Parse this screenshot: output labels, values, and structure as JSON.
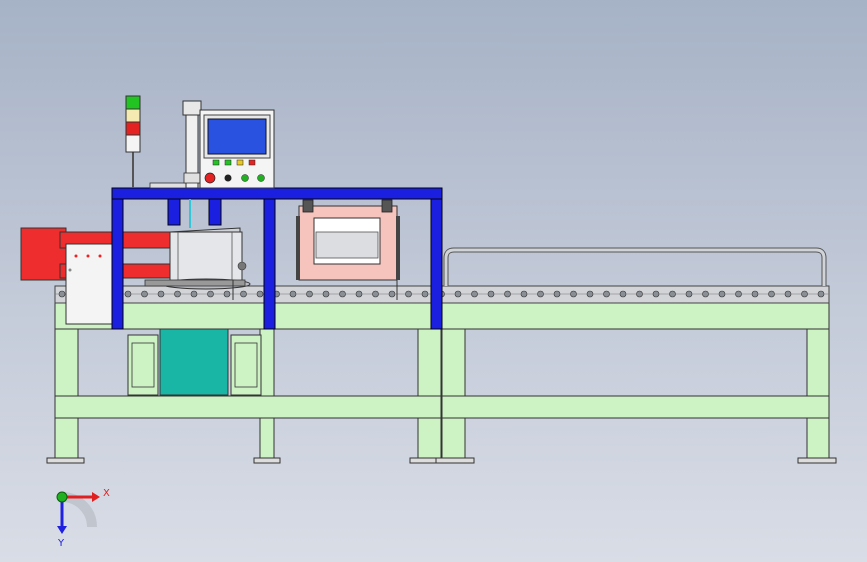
{
  "viewport": {
    "background_top": "#a6b2c6",
    "background_bottom": "#d9dde6"
  },
  "colors": {
    "frame_green": "#cdf2c4",
    "gantry_blue": "#1a1fe0",
    "cylinder_red": "#ee2e2e",
    "clamp_box_pink": "#f7c3bd",
    "motor_teal": "#19b6a6",
    "hmi_screen": "#2a52e0",
    "roller": "#8a8f96",
    "rail": "#c9ccd2"
  },
  "tower_light": {
    "segments": [
      "green",
      "yellow",
      "red"
    ]
  },
  "control_panel": {
    "icon": "hmi-touchscreen-icon",
    "indicators": [
      "green",
      "green",
      "yellow",
      "red"
    ],
    "controls": [
      "emergency-stop-icon",
      "selector-switch-icon",
      "green-push-button-icon",
      "green-push-button-icon"
    ]
  },
  "axis_triad": {
    "x_label": "X",
    "y_label": "Y",
    "x_color": "#e02020",
    "y_color": "#20b020",
    "z_color": "#2020e0"
  }
}
